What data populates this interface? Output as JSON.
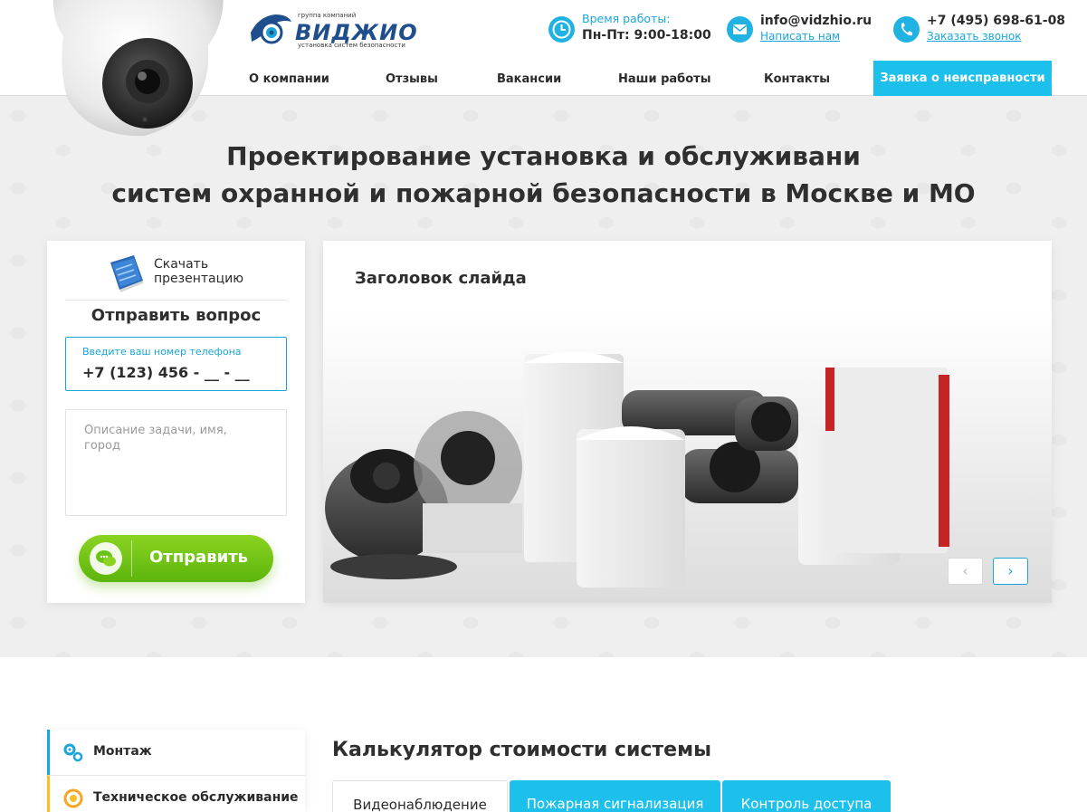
{
  "header": {
    "logo": {
      "tagline_top": "группа компаний",
      "brand": "ВИДЖИО",
      "tagline_bottom": "установка систем безопасности"
    },
    "hours": {
      "label": "Время работы:",
      "value": "Пн-Пт: 9:00-18:00",
      "icon": "clock-icon"
    },
    "email": {
      "value": "info@vidzhio.ru",
      "link": "Написать нам",
      "icon": "mail-icon"
    },
    "phone": {
      "value": "+7 (495) 698-61-08",
      "link": "Заказать звонок",
      "icon": "phone-icon"
    }
  },
  "nav": {
    "items": [
      "О компании",
      "Отзывы",
      "Вакансии",
      "Наши работы",
      "Контакты"
    ],
    "cta": "Заявка о неисправности"
  },
  "hero": {
    "title_line1": "Проектирование установка и обслуживани",
    "title_line2": "систем охранной и пожарной безопасности в Москве и МО"
  },
  "form": {
    "download": "Скачать презентацию",
    "title": "Отправить вопрос",
    "phone_label": "Введите ваш номер телефона",
    "phone_value": "+7 (123) 456 - __ - __",
    "description_placeholder": "Описание задачи, имя, город",
    "submit": "Отправить"
  },
  "slider": {
    "title": "Заголовок слайда",
    "prev": "‹",
    "next": "›"
  },
  "services_menu": [
    {
      "label": "Монтаж",
      "icon": "gears-icon"
    },
    {
      "label": "Техническое обслуживание",
      "icon": "maintenance-icon"
    }
  ],
  "calculator": {
    "title": "Калькулятор стоимости системы",
    "tabs": [
      "Видеонаблюдение",
      "Пожарная сигнализация",
      "Контроль доступа"
    ],
    "active_tab": "Видеонаблюдение"
  },
  "colors": {
    "accent": "#1cc0ea",
    "link": "#1aa6d8",
    "button_green": "#6cc316",
    "brand_blue": "#1e4e8c"
  }
}
